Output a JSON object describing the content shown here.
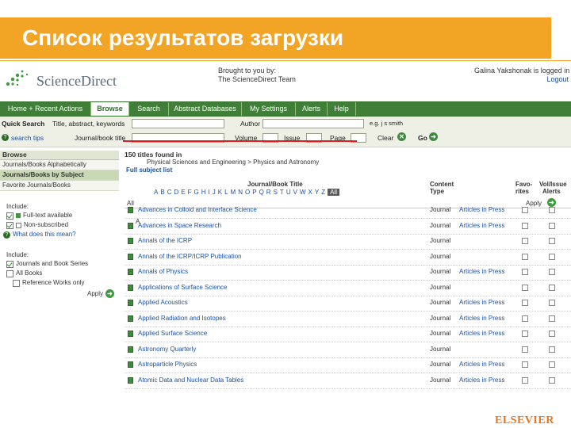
{
  "slide": {
    "title": "Список результатов загрузки",
    "publisher": "ELSEVIER"
  },
  "header": {
    "logo_text": "ScienceDirect",
    "brought_line1": "Brought to you by:",
    "brought_line2": "The ScienceDirect Team",
    "logged_in": "Galina Yakshonak is logged in",
    "logout": "Logout"
  },
  "nav": {
    "items": [
      {
        "label": "Home + Recent Actions"
      },
      {
        "label": "Browse"
      },
      {
        "label": "Search"
      },
      {
        "label": "Abstract Databases"
      },
      {
        "label": "My Settings"
      },
      {
        "label": "Alerts"
      },
      {
        "label": "Help"
      }
    ]
  },
  "quick_search": {
    "label": "Quick Search",
    "search_tips": "search tips",
    "title_label": "Title, abstract, keywords",
    "author_label": "Author",
    "author_example": "e.g. j s smith",
    "journal_label": "Journal/book title",
    "volume_label": "Volume",
    "issue_label": "Issue",
    "page_label": "Page",
    "clear_label": "Clear",
    "go_label": "Go"
  },
  "sidebar": {
    "browse_label": "Browse",
    "items": [
      {
        "label": "Journals/Books Alphabetically"
      },
      {
        "label": "Journals/Books by Subject"
      },
      {
        "label": "Favorite Journals/Books"
      }
    ],
    "include_label": "Include:",
    "access_options": [
      {
        "label": "Full-text available",
        "checked": true
      },
      {
        "label": "Non-subscribed",
        "checked": true
      }
    ],
    "what_link": "What does this mean?",
    "include2_label": "Include:",
    "type_options": [
      {
        "label": "Journals and Book Series",
        "checked": true
      },
      {
        "label": "All Books",
        "checked": false
      },
      {
        "label": "Reference Works only",
        "checked": false
      }
    ],
    "apply_label": "Apply"
  },
  "results": {
    "count_text": "150 titles found in",
    "breadcrumb": "Physical Sciences and Engineering > Physics and Astronomy",
    "full_subject_list": "Full subject list",
    "col_title": "Journal/Book Title",
    "col_content_line1": "Content",
    "col_content_line2": "Type",
    "col_fav_line1": "Favo-",
    "col_fav_line2": "rites",
    "col_vol_line1": "Vol/Issue",
    "col_vol_line2": "Alerts",
    "alphabet": [
      "A",
      "B",
      "C",
      "D",
      "E",
      "F",
      "G",
      "H",
      "I",
      "J",
      "K",
      "L",
      "M",
      "N",
      "O",
      "P",
      "Q",
      "R",
      "S",
      "T",
      "U",
      "V",
      "W",
      "X",
      "Y",
      "Z"
    ],
    "alphabet_all": "All",
    "all_label": "All",
    "apply_label": "Apply",
    "letter_heading": "A",
    "rows": [
      {
        "title": "Advances in Colloid and Interface Science",
        "type": "Journal",
        "access": "Articles in Press"
      },
      {
        "title": "Advances in Space Research",
        "type": "Journal",
        "access": "Articles in Press"
      },
      {
        "title": "Annals of the ICRP",
        "type": "Journal",
        "access": ""
      },
      {
        "title": "Annals of the ICRP/ICRP Publication",
        "type": "Journal",
        "access": ""
      },
      {
        "title": "Annals of Physics",
        "type": "Journal",
        "access": "Articles in Press"
      },
      {
        "title": "Applications of Surface Science",
        "type": "Journal",
        "access": ""
      },
      {
        "title": "Applied Acoustics",
        "type": "Journal",
        "access": "Articles in Press"
      },
      {
        "title": "Applied Radiation and Isotopes",
        "type": "Journal",
        "access": "Articles in Press"
      },
      {
        "title": "Applied Surface Science",
        "type": "Journal",
        "access": "Articles in Press"
      },
      {
        "title": "Astronomy Quarterly",
        "type": "Journal",
        "access": ""
      },
      {
        "title": "Astroparticle Physics",
        "type": "Journal",
        "access": "Articles in Press"
      },
      {
        "title": "Atomic Data and Nuclear Data Tables",
        "type": "Journal",
        "access": "Articles in Press"
      }
    ]
  }
}
